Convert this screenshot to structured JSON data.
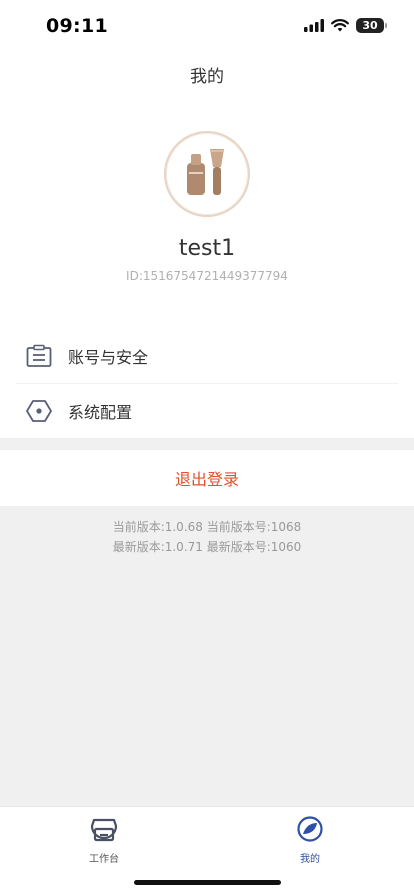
{
  "status_bar": {
    "time": "09:11",
    "battery": "30"
  },
  "header": {
    "title": "我的"
  },
  "profile": {
    "username": "test1",
    "user_id": "ID:1516754721449377794"
  },
  "menu": {
    "items": [
      {
        "label": "账号与安全",
        "icon": "id-card-icon"
      },
      {
        "label": "系统配置",
        "icon": "hexagon-settings-icon"
      }
    ]
  },
  "logout": {
    "label": "退出登录",
    "color": "#e0502f"
  },
  "version": {
    "current": "当前版本:1.0.68 当前版本号:1068",
    "latest": "最新版本:1.0.71 最新版本号:1060"
  },
  "tabbar": {
    "tabs": [
      {
        "label": "工作台",
        "icon": "store-icon",
        "active": false
      },
      {
        "label": "我的",
        "icon": "profile-icon",
        "active": true
      }
    ],
    "active_color": "#2f4fa8"
  }
}
